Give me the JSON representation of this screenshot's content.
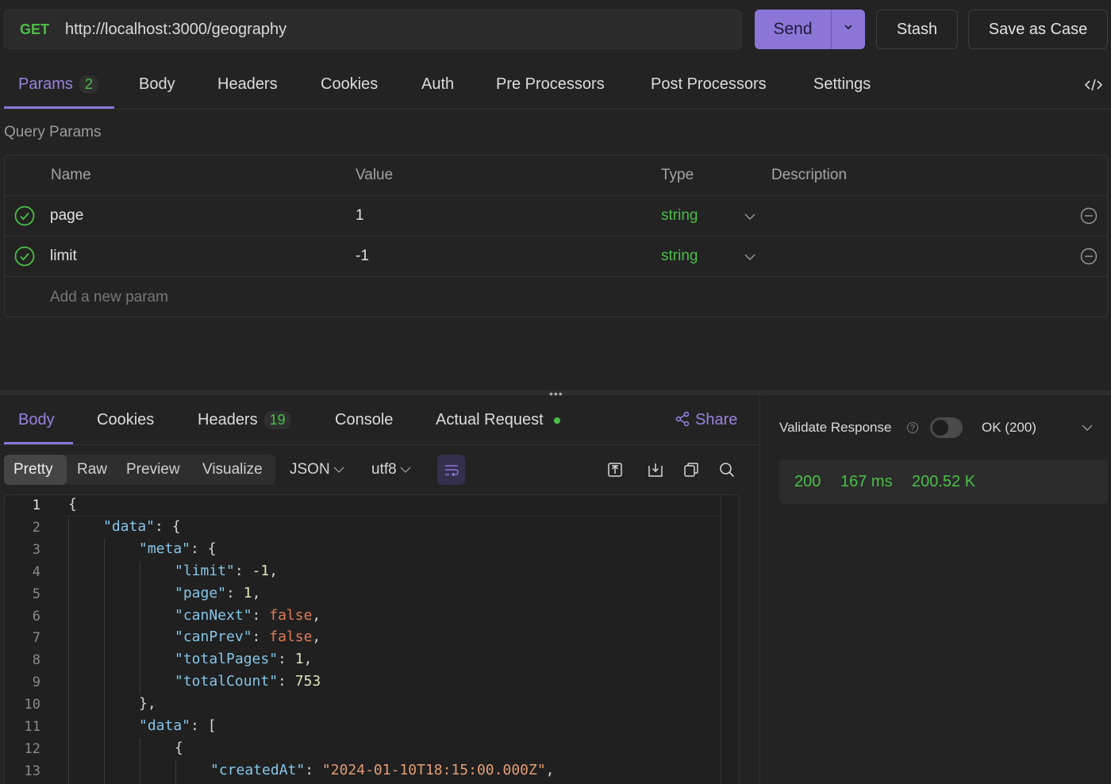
{
  "request": {
    "method": "GET",
    "url": "http://localhost:3000/geography",
    "send_label": "Send",
    "stash_label": "Stash",
    "save_case_label": "Save as Case"
  },
  "request_tabs": {
    "params": "Params",
    "params_count": "2",
    "body": "Body",
    "headers": "Headers",
    "cookies": "Cookies",
    "auth": "Auth",
    "pre": "Pre Processors",
    "post": "Post Processors",
    "settings": "Settings"
  },
  "query_params": {
    "title": "Query Params",
    "headers": {
      "name": "Name",
      "value": "Value",
      "type": "Type",
      "description": "Description"
    },
    "rows": [
      {
        "name": "page",
        "value": "1",
        "type": "string"
      },
      {
        "name": "limit",
        "value": "-1",
        "type": "string"
      }
    ],
    "add_placeholder": "Add a new param"
  },
  "splitter_dots": "•••",
  "response_tabs": {
    "body": "Body",
    "cookies": "Cookies",
    "headers": "Headers",
    "headers_count": "19",
    "console": "Console",
    "actual_request": "Actual Request",
    "share": "Share"
  },
  "view_toolbar": {
    "pretty": "Pretty",
    "raw": "Raw",
    "preview": "Preview",
    "visualize": "Visualize",
    "format": "JSON",
    "encoding": "utf8"
  },
  "editor": {
    "line_numbers": [
      "1",
      "2",
      "3",
      "4",
      "5",
      "6",
      "7",
      "8",
      "9",
      "10",
      "11",
      "12",
      "13"
    ],
    "lines": [
      "{",
      "\"data\": {",
      "\"meta\": {",
      "\"limit\": -1,",
      "\"page\": 1,",
      "\"canNext\": false,",
      "\"canPrev\": false,",
      "\"totalPages\": 1,",
      "\"totalCount\": 753",
      "},",
      "\"data\": [",
      "{",
      "\"createdAt\": \"2024-01-10T18:15:00.000Z\","
    ]
  },
  "validate": {
    "label": "Validate Response",
    "status_select": "OK (200)"
  },
  "status": {
    "code": "200",
    "time": "167 ms",
    "size": "200.52 K"
  },
  "colors": {
    "accent": "#8b76d8",
    "success": "#4bbf48",
    "background": "#232323"
  },
  "icons": [
    "chevron-down-icon",
    "code-icon",
    "check-circle-icon",
    "minus-circle-icon",
    "share-icon",
    "wrap-icon",
    "export-icon",
    "download-icon",
    "copy-icon",
    "search-icon",
    "help-icon"
  ]
}
